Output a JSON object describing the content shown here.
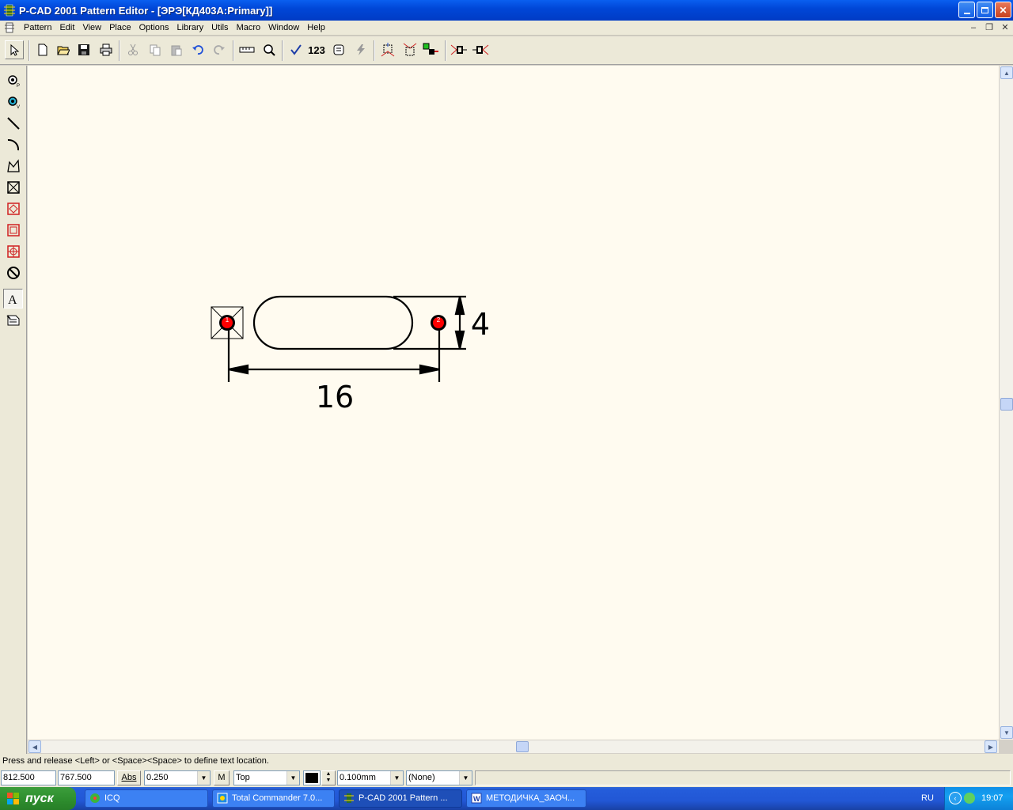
{
  "window": {
    "title": "P-CAD 2001 Pattern Editor - [ЭРЭ[КД403А:Primary]]",
    "minimize_icon": "minimize-icon",
    "maximize_icon": "restore-icon",
    "close_icon": "close-icon"
  },
  "menu": {
    "items": [
      "Pattern",
      "Edit",
      "View",
      "Place",
      "Options",
      "Library",
      "Utils",
      "Macro",
      "Window",
      "Help"
    ]
  },
  "toolbar": {
    "icons": [
      "select-arrow-icon",
      "new-file-icon",
      "open-folder-icon",
      "save-icon",
      "print-icon",
      "cut-icon",
      "copy-icon",
      "paste-icon",
      "undo-icon",
      "redo-icon",
      "measure-icon",
      "zoom-icon",
      "check-icon",
      "renumber-icon",
      "pattern-wizard-icon",
      "lightning-icon",
      "snap-icon-1",
      "snap-icon-2",
      "snap-icon-3",
      "dimension-icon-1",
      "dimension-icon-2"
    ],
    "renumber_label": "123"
  },
  "palette": {
    "icons": [
      "place-pad-icon",
      "place-via-icon",
      "place-line-icon",
      "place-arc-icon",
      "place-polygon-icon",
      "place-keepout-icon",
      "place-copper-icon",
      "place-cutout-icon",
      "place-plane-icon",
      "no-connect-icon",
      "place-text-icon",
      "place-attribute-icon"
    ]
  },
  "drawing": {
    "pad1_number": "1",
    "pad2_number": "2",
    "dim_width_text": "16",
    "dim_height_text": "4",
    "pad_color": "#ff0000",
    "line_color": "#000000"
  },
  "status": {
    "message": "Press and release <Left> or <Space><Space> to define text location.",
    "x_coord": "812.500",
    "y_coord": "767.500",
    "abs_label": "Abs",
    "grid_value": "0.250",
    "m_label": "M",
    "layer": "Top",
    "line_width": "0.100mm",
    "net": "(None)"
  },
  "taskbar": {
    "start_label": "пуск",
    "tasks": [
      "ICQ",
      "Total Commander 7.0...",
      "P-CAD 2001 Pattern ...",
      "МЕТОДИЧКА_ЗАОЧ..."
    ],
    "lang": "RU",
    "clock": "19:07"
  }
}
